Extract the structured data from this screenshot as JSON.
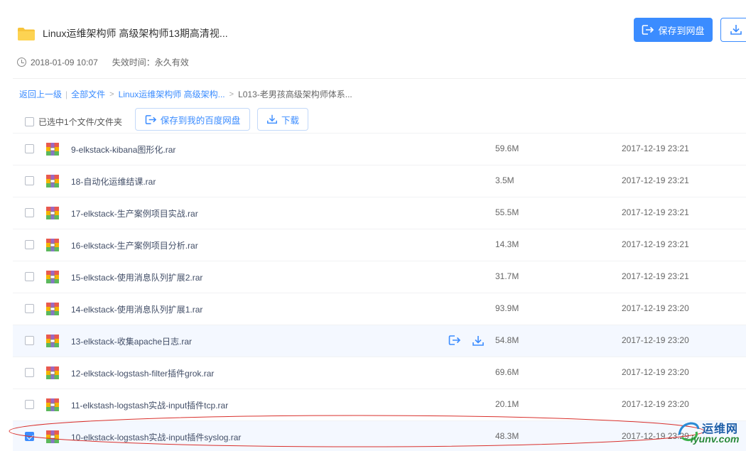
{
  "share": {
    "title": "Linux运维架构师 高级架构师13期高清视...",
    "date": "2018-01-09 10:07",
    "expire": "失效时间：永久有效",
    "save_button": "保存到网盘"
  },
  "breadcrumb": {
    "back": "返回上一级",
    "sep": "|",
    "all_files": "全部文件",
    "folder1": "Linux运维架构师 高级架构...",
    "folder2": "L013-老男孩高级架构师体系..."
  },
  "toolbar": {
    "selected_label": "已选中1个文件/文件夹",
    "save_label": "保存到我的百度网盘",
    "download_label": "下载"
  },
  "files": [
    {
      "name": "9-elkstack-kibana图形化.rar",
      "size": "59.6M",
      "time": "2017-12-19 23:21",
      "checked": false
    },
    {
      "name": "18-自动化运维结课.rar",
      "size": "3.5M",
      "time": "2017-12-19 23:21",
      "checked": false
    },
    {
      "name": "17-elkstack-生产案例项目实战.rar",
      "size": "55.5M",
      "time": "2017-12-19 23:21",
      "checked": false
    },
    {
      "name": "16-elkstack-生产案例项目分析.rar",
      "size": "14.3M",
      "time": "2017-12-19 23:21",
      "checked": false
    },
    {
      "name": "15-elkstack-使用消息队列扩展2.rar",
      "size": "31.7M",
      "time": "2017-12-19 23:21",
      "checked": false
    },
    {
      "name": "14-elkstack-使用消息队列扩展1.rar",
      "size": "93.9M",
      "time": "2017-12-19 23:20",
      "checked": false
    },
    {
      "name": "13-elkstack-收集apache日志.rar",
      "size": "54.8M",
      "time": "2017-12-19 23:20",
      "checked": false,
      "hover": true
    },
    {
      "name": "12-elkstack-logstash-filter插件grok.rar",
      "size": "69.6M",
      "time": "2017-12-19 23:20",
      "checked": false
    },
    {
      "name": "11-elkstash-logstash实战-input插件tcp.rar",
      "size": "20.1M",
      "time": "2017-12-19 23:20",
      "checked": false
    },
    {
      "name": "10-elkstack-logstash实战-input插件syslog.rar",
      "size": "48.3M",
      "time": "2017-12-19 23:29",
      "checked": true
    }
  ],
  "watermark": {
    "cn": "运维网",
    "en": "iyunv.com"
  },
  "colors": {
    "accent": "#3b8cff",
    "annotation": "#d9302c"
  }
}
